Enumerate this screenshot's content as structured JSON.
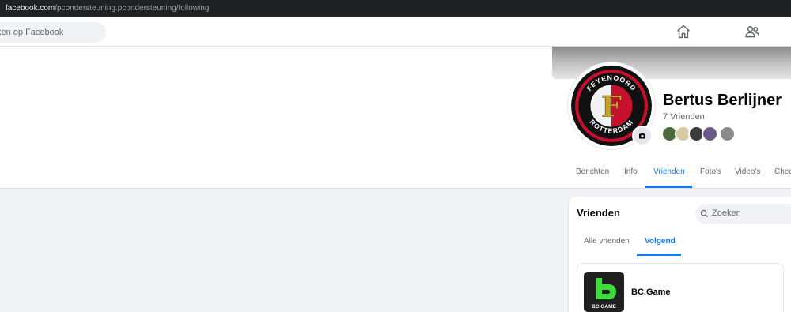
{
  "browser": {
    "url_host": "facebook.com",
    "url_path": "/pcondersteuning.pcondersteuning/following"
  },
  "topnav": {
    "search_placeholder": "ken op Facebook",
    "icons": [
      "home-icon",
      "friends-icon"
    ]
  },
  "profile": {
    "name": "Bertus Berlijner",
    "friend_count": "7 Vrienden",
    "avatar_ring_text_top": "FEYENOORD",
    "avatar_ring_text_bottom": "ROTTERDAM",
    "friend_avatar_colors": [
      "#4a6b3a",
      "#d8c9a3",
      "#3a3a3a",
      "#6a5a8a",
      "#8a8a8a"
    ]
  },
  "tabs": [
    {
      "label": "Berichten",
      "active": false
    },
    {
      "label": "Info",
      "active": false
    },
    {
      "label": "Vrienden",
      "active": true
    },
    {
      "label": "Foto's",
      "active": false
    },
    {
      "label": "Video's",
      "active": false
    },
    {
      "label": "Chec",
      "active": false
    }
  ],
  "friends_section": {
    "title": "Vrienden",
    "search_placeholder": "Zoeken",
    "subtabs": [
      {
        "label": "Alle vrienden",
        "active": false
      },
      {
        "label": "Volgend",
        "active": true
      }
    ],
    "entries": [
      {
        "name": "BC.Game",
        "logo_text": "BC.GAME"
      }
    ]
  },
  "colors": {
    "accent": "#1877f2",
    "feyenoord_red": "#c8102e",
    "bcgame_green": "#3ddc3a"
  }
}
